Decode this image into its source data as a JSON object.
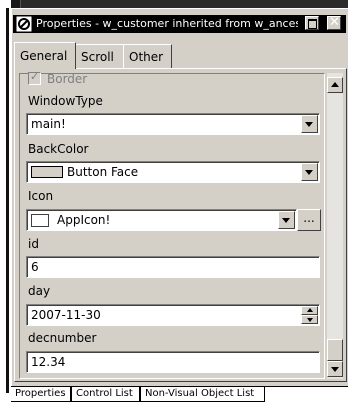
{
  "window": {
    "title": "Properties - w_customer inherited from w_ances"
  },
  "tabs": [
    {
      "label": "General"
    },
    {
      "label": "Scroll"
    },
    {
      "label": "Other"
    }
  ],
  "props": {
    "border_label": "Border",
    "windowtype_label": "WindowType",
    "windowtype_value": "main!",
    "backcolor_label": "BackColor",
    "backcolor_value": "Button Face",
    "icon_label": "Icon",
    "icon_value": "AppIcon!",
    "ellipsis": "...",
    "id_label": "id",
    "id_value": "6",
    "day_label": "day",
    "day_value": "2007-11-30",
    "decnumber_label": "decnumber",
    "decnumber_value": "12.34"
  },
  "bottom_tabs": [
    {
      "label": "Properties"
    },
    {
      "label": "Control List"
    },
    {
      "label": "Non-Visual Object List"
    }
  ]
}
